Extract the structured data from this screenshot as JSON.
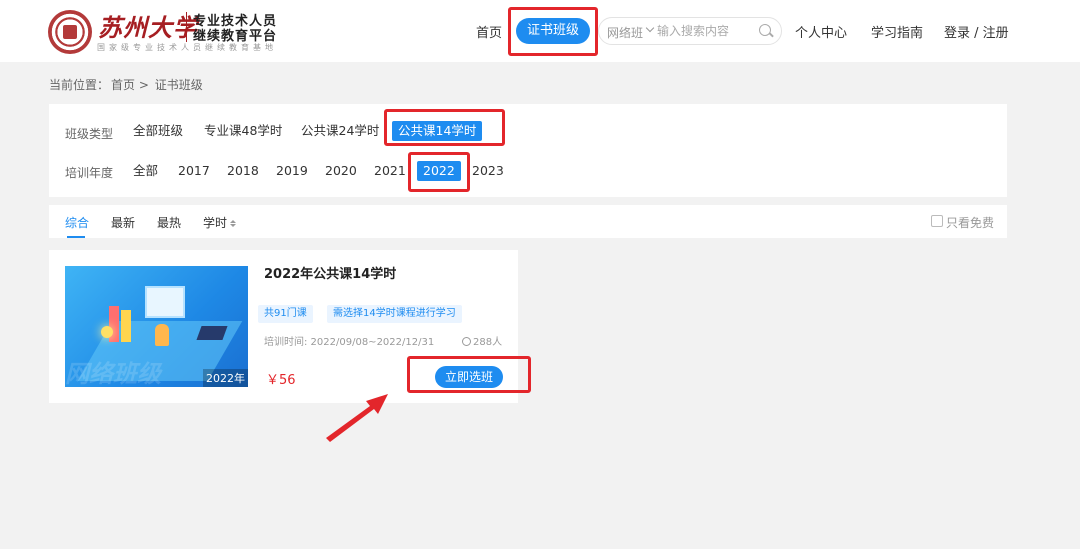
{
  "header": {
    "logo": {
      "script_text": "苏州大学",
      "line1": "专业技术人员",
      "line2": "继续教育平台",
      "line3": "国家级专业技术人员继续教育基地"
    },
    "nav": {
      "home": "首页",
      "certificate_classes": "证书班级",
      "personal_center": "个人中心",
      "study_guide": "学习指南",
      "login_register": "登录 / 注册"
    },
    "search": {
      "type": "网络班",
      "placeholder": "输入搜索内容",
      "icon": "search-icon"
    }
  },
  "breadcrumb": {
    "prefix": "当前位置：",
    "home": "首页",
    "separator": ">",
    "current": "证书班级"
  },
  "filters": {
    "class_type": {
      "label": "班级类型",
      "options": [
        "全部班级",
        "专业课48学时",
        "公共课24学时",
        "公共课14学时"
      ],
      "selected": "公共课14学时"
    },
    "training_year": {
      "label": "培训年度",
      "options": [
        "全部",
        "2017",
        "2018",
        "2019",
        "2020",
        "2021",
        "2022",
        "2023"
      ],
      "selected": "2022"
    }
  },
  "sort": {
    "options": [
      "综合",
      "最新",
      "最热",
      "学时"
    ],
    "selected": "综合",
    "free_only_label": "只看免费",
    "free_only_checked": false
  },
  "courses": [
    {
      "title": "2022年公共课14学时",
      "thumb_watermark": "网络班级",
      "thumb_year": "2022年",
      "tag_count": "共91门课",
      "tag_note": "需选择14学时课程进行学习",
      "date": "培训时间: 2022/09/08~2022/12/31",
      "people": "288人",
      "price": "￥56",
      "button": "立即选班"
    }
  ],
  "colors": {
    "primary": "#1e8cf0",
    "highlight_box": "#e3262b",
    "price": "#e3262b",
    "brand": "#a61e22"
  }
}
